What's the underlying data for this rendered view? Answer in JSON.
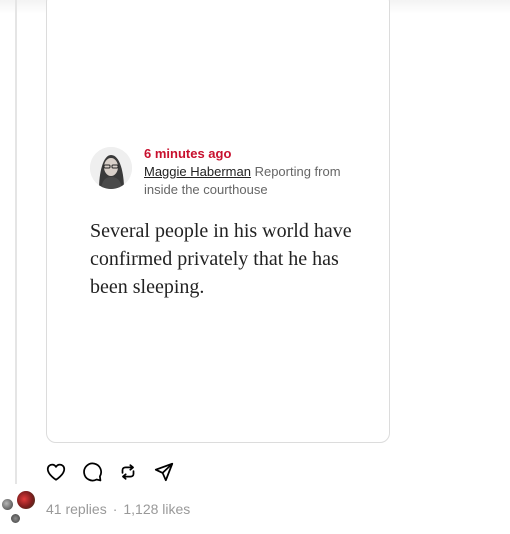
{
  "embed": {
    "time": "6 minutes ago",
    "author": "Maggie Haberman",
    "context": "Reporting from inside the courthouse",
    "quote": "Several people in his world have confirmed privately that he has been sleeping."
  },
  "actions": [
    {
      "icon": "heart-icon",
      "label": "Like"
    },
    {
      "icon": "comment-icon",
      "label": "Reply"
    },
    {
      "icon": "repost-icon",
      "label": "Repost"
    },
    {
      "icon": "share-icon",
      "label": "Share"
    }
  ],
  "stats": {
    "replies": "41 replies",
    "separator": "·",
    "likes": "1,128 likes"
  },
  "colors": {
    "time": "#c8102e",
    "muted": "#999999",
    "border": "#dcdcdc"
  }
}
